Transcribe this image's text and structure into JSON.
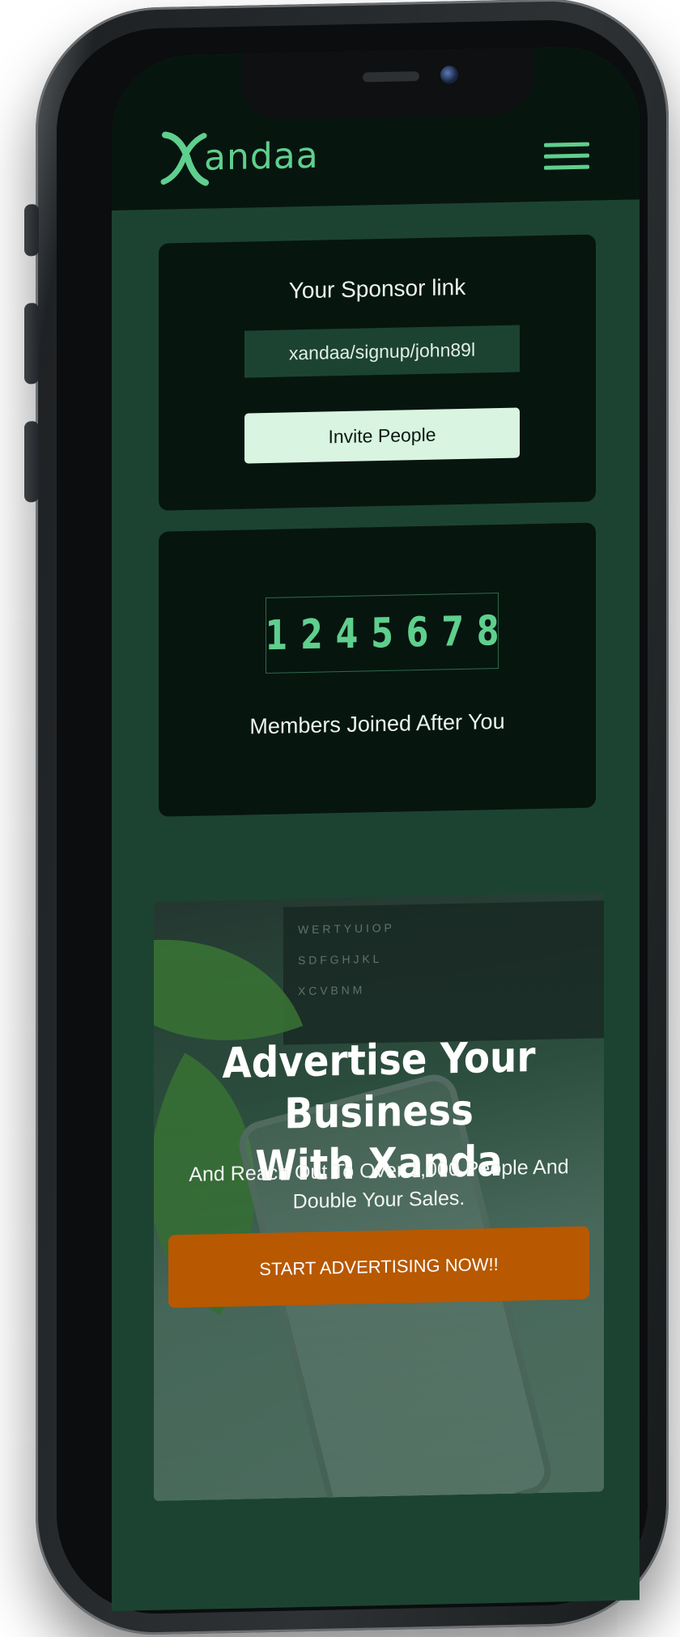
{
  "header": {
    "logo_text": "andaa",
    "logo_icon": "x-mark-logo",
    "menu_icon": "hamburger-icon"
  },
  "sponsor_card": {
    "title": "Your Sponsor link",
    "link": "xandaa/signup/john89l",
    "invite_label": "Invite People"
  },
  "members_card": {
    "digits": [
      "1",
      "2",
      "4",
      "5",
      "6",
      "7",
      "8"
    ],
    "label": "Members Joined After You"
  },
  "advert": {
    "title_line1": "Advertise Your Business",
    "title_line2": "With Xanda",
    "subtitle_line1": "And Reach Out To Over 1,000 People And",
    "subtitle_line2": "Double Your Sales.",
    "cta_label": "START ADVERTISING NOW!!"
  },
  "colors": {
    "brand_green": "#5fcf8d",
    "dark_bg": "#07150f",
    "screen_bg": "#1c4331",
    "cta_orange": "#b85800",
    "invite_button": "#d9f4e0"
  }
}
